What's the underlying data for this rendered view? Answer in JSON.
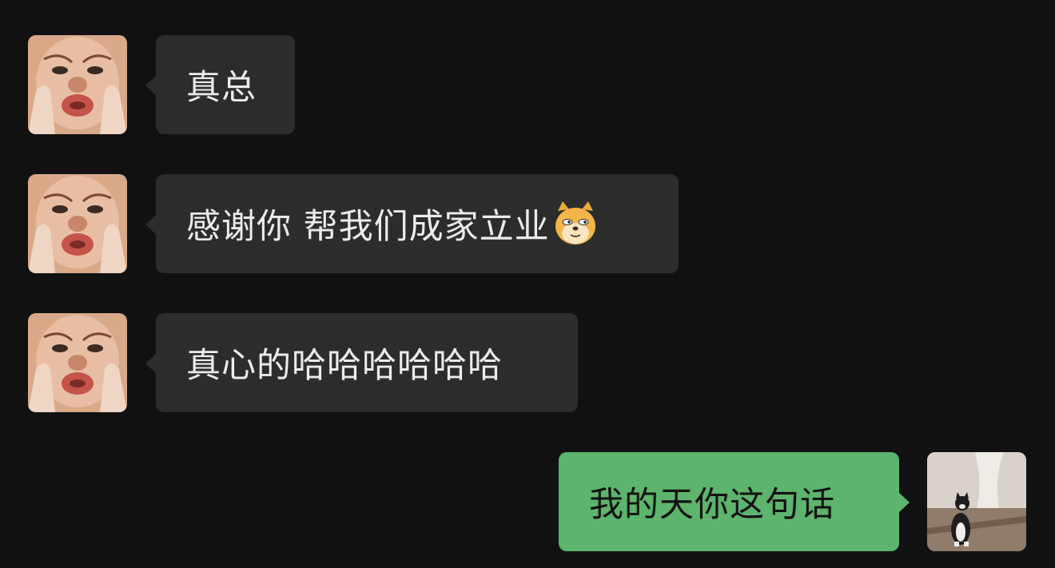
{
  "conversation": {
    "messages": [
      {
        "sender": "contact",
        "text": "真总"
      },
      {
        "sender": "contact",
        "text": "感谢你 帮我们成家立业",
        "emoji": "doge-cat-face-icon"
      },
      {
        "sender": "contact",
        "text": "真心的哈哈哈哈哈哈"
      },
      {
        "sender": "me",
        "text": "我的天你这句话"
      }
    ]
  },
  "colors": {
    "background": "#111111",
    "incoming_bubble": "#2c2c2c",
    "outgoing_bubble": "#5db46d",
    "incoming_text": "#ececec",
    "outgoing_text": "#111111"
  },
  "avatars": {
    "contact": "child-face-avatar",
    "me": "cat-photo-avatar"
  }
}
